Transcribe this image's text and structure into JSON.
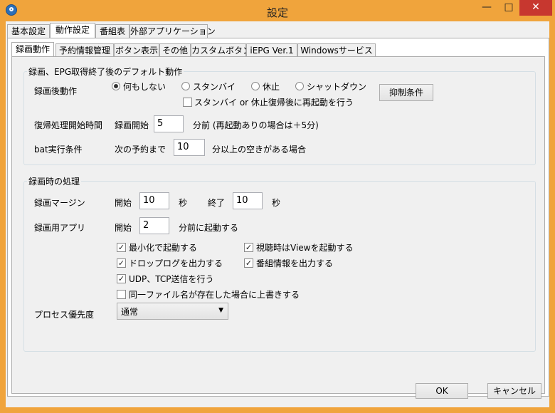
{
  "window": {
    "title": "設定",
    "minimize_glyph": "—",
    "maximize_glyph": "□",
    "close_glyph": "✕"
  },
  "outer_tabs": [
    "基本設定",
    "動作設定",
    "番組表",
    "外部アプリケーション"
  ],
  "inner_tabs": [
    "録画動作",
    "予約情報管理",
    "ボタン表示",
    "その他",
    "カスタムボタン",
    "iEPG Ver.1",
    "Windowsサービス"
  ],
  "group1": {
    "title": "録画、EPG取得終了後のデフォルト動作",
    "after_rec_label": "録画後動作",
    "radio_options": [
      "何もしない",
      "スタンバイ",
      "休止",
      "シャットダウン"
    ],
    "selected_radio": 0,
    "reboot_checkbox_label": "スタンバイ or 休止復帰後に再起動を行う",
    "reboot_checked": false,
    "suppress_button": "抑制条件",
    "resume_label": "復帰処理開始時間",
    "rec_start_label": "録画開始",
    "rec_start_value": "5",
    "rec_start_suffix": "分前 (再起動ありの場合は＋5分)",
    "bat_label": "bat実行条件",
    "next_rec_label": "次の予約まで",
    "next_rec_value": "10",
    "next_rec_suffix": "分以上の空きがある場合"
  },
  "group2": {
    "title": "録画時の処理",
    "margin_label": "録画マージン",
    "start_label": "開始",
    "start_value": "10",
    "sec1": "秒",
    "end_label": "終了",
    "end_value": "10",
    "sec2": "秒",
    "app_label": "録画用アプリ",
    "app_start_label": "開始",
    "app_start_value": "2",
    "app_suffix": "分前に起動する",
    "checkboxes": [
      {
        "label": "最小化で起動する",
        "checked": true
      },
      {
        "label": "視聴時はViewを起動する",
        "checked": true
      },
      {
        "label": "ドロップログを出力する",
        "checked": true
      },
      {
        "label": "番組情報を出力する",
        "checked": true
      },
      {
        "label": "UDP、TCP送信を行う",
        "checked": true
      },
      {
        "label": "同一ファイル名が存在した場合に上書きする",
        "checked": false
      }
    ],
    "priority_label": "プロセス優先度",
    "priority_value": "通常"
  },
  "footer": {
    "ok": "OK",
    "cancel": "キャンセル"
  },
  "colors": {
    "title_bar": "#f0a43c",
    "close_button": "#c7372f",
    "dialog_bg": "#f0f0f0"
  }
}
